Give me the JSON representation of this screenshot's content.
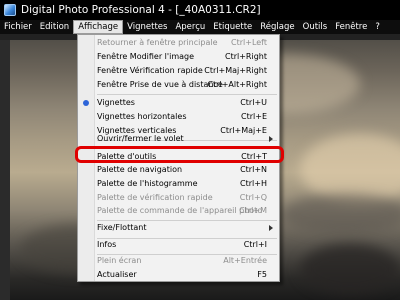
{
  "window": {
    "title": "Digital Photo Professional 4 - [_40A0311.CR2]"
  },
  "menubar": {
    "items": [
      "Fichier",
      "Edition",
      "Affichage",
      "Vignettes",
      "Aperçu",
      "Etiquette",
      "Réglage",
      "Outils",
      "Fenêtre",
      "?"
    ],
    "active": "Affichage"
  },
  "menu": {
    "items": [
      {
        "label": "Retourner à fenêtre principale",
        "shortcut": "Ctrl+Left"
      },
      {
        "label": "Fenêtre Modifier l'image",
        "shortcut": "Ctrl+Right"
      },
      {
        "label": "Fenêtre Vérification rapide",
        "shortcut": "Ctrl+Maj+Right"
      },
      {
        "label": "Fenêtre Prise de vue à distance",
        "shortcut": "Ctrl+Alt+Right"
      },
      {
        "label": "Vignettes",
        "shortcut": "Ctrl+U"
      },
      {
        "label": "Vignettes horizontales",
        "shortcut": "Ctrl+E"
      },
      {
        "label": "Vignettes verticales",
        "shortcut": "Ctrl+Maj+E"
      },
      {
        "label": "Ouvrir/fermer le volet",
        "shortcut": ""
      },
      {
        "label": "Palette d'outils",
        "shortcut": "Ctrl+T"
      },
      {
        "label": "Palette de navigation",
        "shortcut": "Ctrl+N"
      },
      {
        "label": "Palette de l'histogramme",
        "shortcut": "Ctrl+H"
      },
      {
        "label": "Palette de vérification rapide",
        "shortcut": "Ctrl+Q"
      },
      {
        "label": "Palette de commande de l'appareil photo",
        "shortcut": "Ctrl+M"
      },
      {
        "label": "Fixe/Flottant",
        "shortcut": ""
      },
      {
        "label": "Infos",
        "shortcut": "Ctrl+I"
      },
      {
        "label": "Plein écran",
        "shortcut": "Alt+Entrée"
      },
      {
        "label": "Actualiser",
        "shortcut": "F5"
      }
    ],
    "checked_item": "Vignettes",
    "highlighted_item": "Palette d'outils"
  },
  "colors": {
    "titlebar_bg": "#000000",
    "menu_bg": "#f2f2f2",
    "highlight_border": "#e00000",
    "radio_dot": "#2d64d8"
  }
}
